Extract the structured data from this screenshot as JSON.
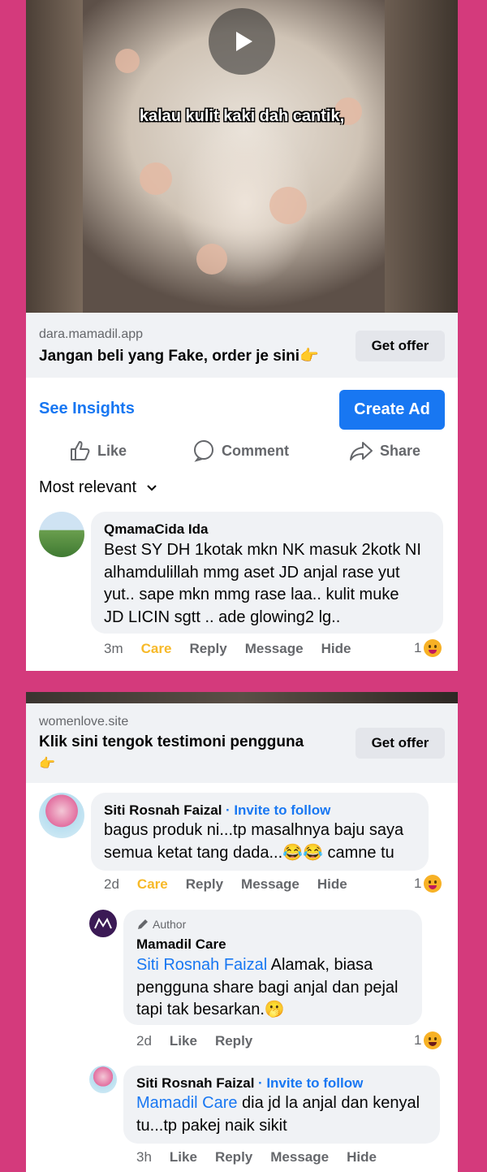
{
  "ad1": {
    "video_caption": "kalau kulit kaki dah cantik,",
    "domain": "dara.mamadil.app",
    "headline": "Jangan beli yang Fake, order je sini👉",
    "offer_label": "Get offer"
  },
  "toolbar": {
    "insights_label": "See Insights",
    "create_ad_label": "Create Ad",
    "like_label": "Like",
    "comment_label": "Comment",
    "share_label": "Share",
    "sort_label": "Most relevant"
  },
  "comment1": {
    "author": "QmamaCida Ida",
    "text_lines": [
      "Best SY DH 1kotak mkn NK masuk 2kotk NI",
      "alhamdulillah mmg aset JD anjal rase yut",
      "yut.. sape mkn mmg rase laa..  kulit muke",
      "JD LICIN sgtt .. ade glowing2 lg.."
    ],
    "time": "3m",
    "care": "Care",
    "reply": "Reply",
    "message": "Message",
    "hide": "Hide",
    "reaction_count": "1"
  },
  "ad2": {
    "domain": "womenlove.site",
    "headline": "Klik sini tengok testimoni pengguna",
    "headline_emoji": "👉",
    "offer_label": "Get offer"
  },
  "comment2": {
    "author": "Siti Rosnah Faizal",
    "invite": "· Invite to follow",
    "text_lines": [
      "bagus produk ni...tp masalhnya baju saya",
      "semua ketat tang dada...😂😂 camne tu"
    ],
    "time": "2d",
    "care": "Care",
    "reply": "Reply",
    "message": "Message",
    "hide": "Hide",
    "reaction_count": "1"
  },
  "reply1": {
    "badge": "Author",
    "author": "Mamadil Care",
    "mention": "Siti Rosnah Faizal",
    "text_line1": " Alamak, biasa",
    "text_lines": [
      "pengguna share bagi anjal dan pejal",
      "tapi tak besarkan.🫢"
    ],
    "time": "2d",
    "like": "Like",
    "reply": "Reply",
    "reaction_count": "1"
  },
  "reply2": {
    "author": "Siti Rosnah Faizal",
    "invite": "· Invite to follow",
    "mention": "Mamadil Care",
    "text_line1": " dia jd la anjal dan kenyal",
    "text_line2": "tu...tp pakej naik sikit",
    "time": "3h",
    "like": "Like",
    "reply": "Reply",
    "message": "Message",
    "hide": "Hide"
  },
  "colors": {
    "background": "#d43a7c",
    "accent": "#1877f2",
    "care": "#f7b928"
  }
}
